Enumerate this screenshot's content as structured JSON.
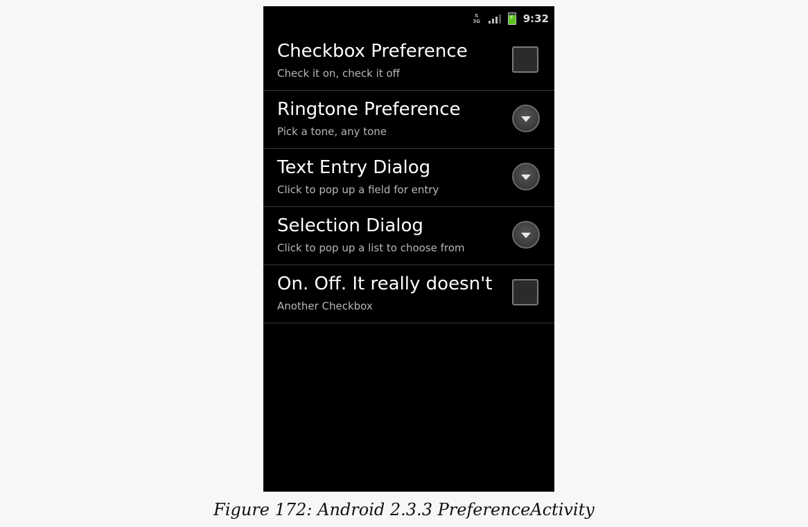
{
  "status_bar": {
    "network": "3G",
    "time": "9:32",
    "icons": [
      "data-3g-icon",
      "signal-icon",
      "battery-charging-icon"
    ]
  },
  "preferences": [
    {
      "title": "Checkbox Preference",
      "summary": "Check it on, check it off",
      "widget": "checkbox",
      "checked": false
    },
    {
      "title": "Ringtone Preference",
      "summary": "Pick a tone, any tone",
      "widget": "dropdown"
    },
    {
      "title": "Text Entry Dialog",
      "summary": "Click to pop up a field for entry",
      "widget": "dropdown"
    },
    {
      "title": "Selection Dialog",
      "summary": "Click to pop up a list to choose from",
      "widget": "dropdown"
    },
    {
      "title": "On. Off. It really doesn't",
      "summary": "Another Checkbox",
      "widget": "checkbox",
      "checked": false
    }
  ],
  "caption": "Figure 172: Android 2.3.3 PreferenceActivity",
  "colors": {
    "background": "#000000",
    "title": "#ffffff",
    "summary": "#b8b8b8",
    "divider": "#3a3a3a",
    "page": "#f7f7f7"
  }
}
